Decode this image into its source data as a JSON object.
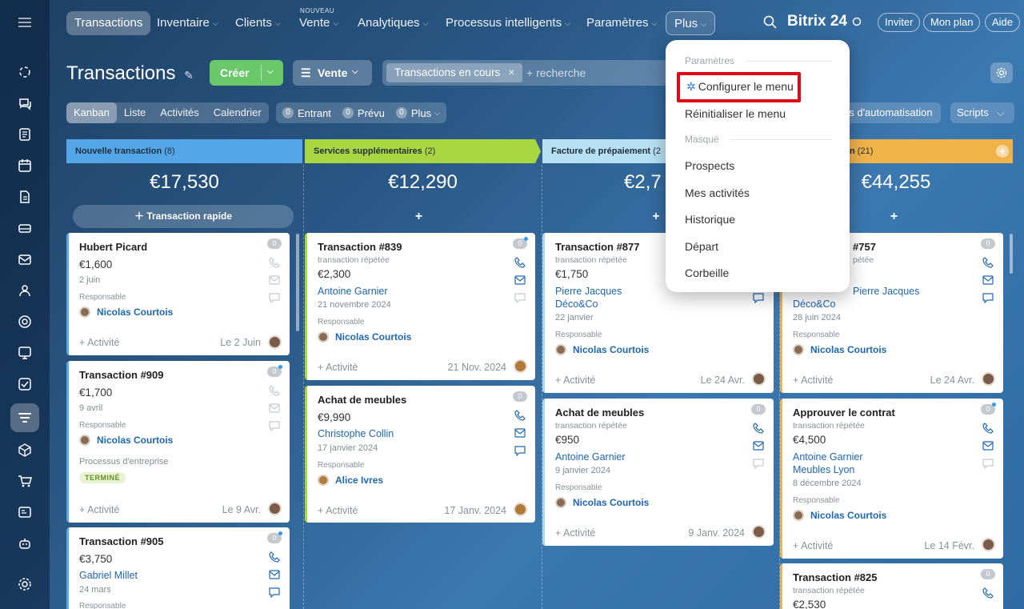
{
  "topnav": {
    "menu_icon": "hamburger-icon",
    "items": [
      {
        "label": "Transactions"
      },
      {
        "label": "Inventaire"
      },
      {
        "label": "Clients"
      },
      {
        "label": "Vente",
        "tag": "NOUVEAU"
      },
      {
        "label": "Analytiques"
      },
      {
        "label": "Processus intelligents"
      },
      {
        "label": "Paramètres"
      },
      {
        "label": "Plus"
      }
    ],
    "brand": "Bitrix 24",
    "invite": "Inviter",
    "plan": "Mon plan",
    "help": "Aide"
  },
  "header": {
    "title": "Transactions",
    "create": "Créer",
    "pipeline": "Vente",
    "filter_tag": "Transactions en cours",
    "search_placeholder": "+ recherche"
  },
  "views": [
    "Kanban",
    "Liste",
    "Activités",
    "Calendrier"
  ],
  "counters": [
    {
      "count": "0",
      "label": "Entrant"
    },
    {
      "count": "0",
      "label": "Prévu"
    },
    {
      "count": "0",
      "label": "Plus"
    }
  ],
  "automation_label": "es d'automatisation",
  "scripts_label": "Scripts",
  "columns": [
    {
      "title": "Nouvelle transaction",
      "count": "(8)",
      "total": "€17,530",
      "quick": "Transaction rapide",
      "color": "#55a6e8"
    },
    {
      "title": "Services supplémentaires",
      "count": "(2)",
      "total": "€12,290",
      "color": "#a9d742"
    },
    {
      "title": "Facture de prépaiement",
      "count": "(2",
      "total": "€2,7",
      "color": "#a8d8f0"
    },
    {
      "title": "n",
      "count": "(21)",
      "total": "€44,255",
      "color": "#f0b34a"
    }
  ],
  "cards": {
    "c1": {
      "title": "Hubert Picard",
      "amount": "€1,600",
      "date": "2 juin",
      "resp_label": "Responsable",
      "resp": "Nicolas Courtois",
      "activity": "+ Activité",
      "due": "Le 2 Juin",
      "badge": "0"
    },
    "c2": {
      "title": "Transaction #909",
      "amount": "€1,700",
      "date": "9 avril",
      "resp_label": "Responsable",
      "resp": "Nicolas Courtois",
      "process": "Processus d'entreprise",
      "status": "TERMINÉ",
      "activity": "+ Activité",
      "due": "Le 9 Avr.",
      "badge": "0"
    },
    "c3": {
      "title": "Transaction #905",
      "amount": "€3,750",
      "contact": "Gabriel Millet",
      "date": "24 mars",
      "resp_label": "Responsable",
      "badge": "0"
    },
    "c4": {
      "title": "Transaction #839",
      "sub": "transaction répétée",
      "amount": "€2,300",
      "contact": "Antoine Garnier",
      "date": "21 novembre 2024",
      "resp_label": "Responsable",
      "resp": "Nicolas Courtois",
      "activity": "+ Activité",
      "due": "21 Nov. 2024",
      "badge": "0"
    },
    "c5": {
      "title": "Achat de meubles",
      "amount": "€9,990",
      "contact": "Christophe Collin",
      "date": "17 janvier 2024",
      "resp_label": "Responsable",
      "resp": "Alice Ivres",
      "activity": "+ Activité",
      "due": "17 Janv. 2024",
      "badge": "0"
    },
    "c6": {
      "title": "Transaction #877",
      "sub": "transaction répétée",
      "amount": "€1,750",
      "contact": "Pierre Jacques",
      "company": "Déco&Co",
      "date": "22 janvier",
      "resp_label": "Responsable",
      "resp": "Nicolas Courtois",
      "activity": "+ Activité",
      "due": "Le 24 Avr."
    },
    "c7": {
      "title": "Achat de meubles",
      "sub": "transaction répétée",
      "amount": "€950",
      "contact": "Antoine Garnier",
      "date": "9 janvier 2024",
      "resp_label": "Responsable",
      "resp": "Nicolas Courtois",
      "activity": "+ Activité",
      "due": "9 Janv. 2024",
      "badge": "0"
    },
    "c8": {
      "title": "#757",
      "sub": "pétée",
      "contact": "Pierre Jacques",
      "company": "Déco&Co",
      "date": "28 juin 2024",
      "resp_label": "Responsable",
      "resp": "Nicolas Courtois",
      "activity": "+ Activité",
      "due": "Le 24 Avr.",
      "badge": "0"
    },
    "c9": {
      "title": "Approuver le contrat",
      "sub": "transaction répétée",
      "amount": "€4,500",
      "contact": "Antoine Garnier",
      "company": "Meubles Lyon",
      "date": "8 décembre 2024",
      "resp_label": "Responsable",
      "resp": "Nicolas Courtois",
      "activity": "+ Activité",
      "due": "Le 14 Févr.",
      "badge": "0"
    },
    "c10": {
      "title": "Transaction #825",
      "sub": "transaction répétée",
      "amount": "€2,530",
      "badge": "0"
    }
  },
  "dropdown": {
    "section1": "Paramètres",
    "configure": "Configurer le menu",
    "reset": "Réinitialiser le menu",
    "section2": "Masqué",
    "hidden_items": [
      "Prospects",
      "Mes activités",
      "Historique",
      "Départ",
      "Corbeille"
    ]
  }
}
